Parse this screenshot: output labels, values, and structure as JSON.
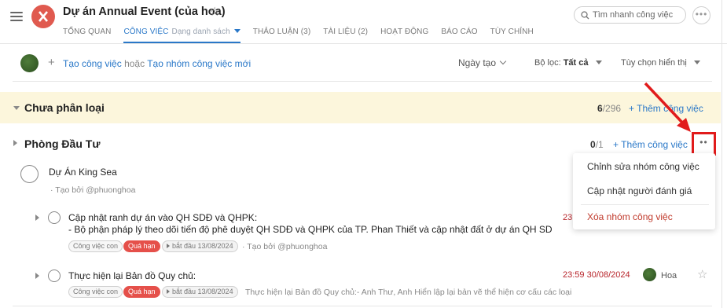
{
  "header": {
    "title": "Dự án Annual Event (của hoa)",
    "tabs": [
      {
        "label": "TỔNG QUAN"
      },
      {
        "label": "CÔNG VIỆC",
        "sub": "Dạng danh sách"
      },
      {
        "label": "THẢO LUẬN (3)"
      },
      {
        "label": "TÀI LIỆU (2)"
      },
      {
        "label": "HOẠT ĐỘNG"
      },
      {
        "label": "BÁO CÁO"
      },
      {
        "label": "TÙY CHỈNH"
      }
    ],
    "search_placeholder": "Tìm nhanh công việc",
    "more": "•••"
  },
  "toolbar": {
    "create_task": "Tạo công việc",
    "or": "hoặc",
    "create_group": "Tạo nhóm công việc mới",
    "sort": "Ngày tạo",
    "filter_label": "Bộ lọc:",
    "filter_value": "Tất cả",
    "display": "Tùy chọn hiển thị"
  },
  "groups": [
    {
      "title": "Chưa phân loại",
      "done": "6",
      "total": "/296",
      "add": "+ Thêm công việc"
    },
    {
      "title": "Phòng Đầu Tư",
      "done": "0",
      "total": "/1",
      "add": "+ Thêm công việc",
      "more": "••"
    }
  ],
  "menu": {
    "items": [
      {
        "label": "Chỉnh sửa nhóm công việc"
      },
      {
        "label": "Cập nhật người đánh giá"
      },
      {
        "label": "Xóa nhóm công việc"
      }
    ]
  },
  "tasks": {
    "parent": {
      "title": "Dự Án King Sea",
      "meta": "· Tạo bởi @phuonghoa"
    },
    "sub1": {
      "title": "Cập nhật ranh dự án vào QH SDĐ và QHPK:",
      "desc": "- Bộ phận pháp lý theo dõi tiến độ phê duyệt QH SDĐ và QHPK của TP. Phan Thiết và cập nhật đất ở dự án QH SD",
      "tag_sub": "Công việc con",
      "tag_overdue": "Quá hạn",
      "tag_start": "bắt đầu 13/08/2024",
      "meta": "· Tạo bởi @phuonghoa",
      "deadline": "23"
    },
    "sub2": {
      "title": "Thực hiện lại Bản đồ Quy chủ:",
      "tag_sub": "Công việc con",
      "tag_overdue": "Quá hạn",
      "tag_start": "bắt đầu 13/08/2024",
      "meta": "Thực hiện lại Bản đồ Quy chủ:- Anh Thư, Anh Hiển lập lại bản vẽ thể hiện cơ cấu các loại",
      "deadline": "23:59 30/08/2024",
      "owner": "Hoa"
    }
  },
  "colors": {
    "accent": "#2a78c8",
    "highlight_bg": "#fcf6dc",
    "danger": "#c0392b",
    "logo": "#e05a4f"
  }
}
